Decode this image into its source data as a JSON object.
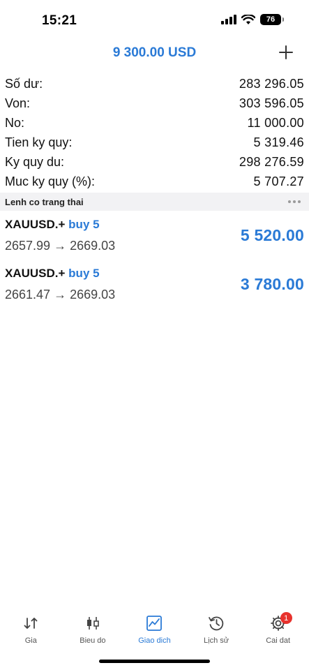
{
  "status_bar": {
    "time": "15:21",
    "battery": "76",
    "icons": [
      "signal-icon",
      "wifi-icon",
      "battery-icon"
    ]
  },
  "header": {
    "title": "9 300.00 USD",
    "add_icon": "plus-icon"
  },
  "summary": [
    {
      "label": "Số dư:",
      "value": "283 296.05"
    },
    {
      "label": "Von:",
      "value": "303 596.05"
    },
    {
      "label": "No:",
      "value": "11 000.00"
    },
    {
      "label": "Tien ky quy:",
      "value": "5 319.46"
    },
    {
      "label": "Ky quy du:",
      "value": "298 276.59"
    },
    {
      "label": "Muc ky quy (%):",
      "value": "5 707.27"
    }
  ],
  "section": {
    "title": "Lenh co trang thai",
    "menu_icon": "more-horizontal-icon"
  },
  "positions": [
    {
      "symbol": "XAUUSD.+",
      "type": "buy 5",
      "open_price": "2657.99",
      "arrow": "→",
      "current_price": "2669.03",
      "profit": "5 520.00"
    },
    {
      "symbol": "XAUUSD.+",
      "type": "buy 5",
      "open_price": "2661.47",
      "arrow": "→",
      "current_price": "2669.03",
      "profit": "3 780.00"
    }
  ],
  "nav": {
    "items": [
      {
        "label": "Gia",
        "icon": "quotes-arrows-icon"
      },
      {
        "label": "Bieu do",
        "icon": "candlestick-chart-icon"
      },
      {
        "label": "Giao dich",
        "icon": "trade-chart-icon"
      },
      {
        "label": "Lịch sử",
        "icon": "history-clock-icon"
      },
      {
        "label": "Cai dat",
        "icon": "gear-icon"
      }
    ],
    "active": "Giao dich",
    "settings_badge": "1"
  },
  "colors": {
    "accent": "#2a7ad6",
    "badge": "#e8322d",
    "section_bg": "#f2f2f4",
    "text": "#111111"
  }
}
